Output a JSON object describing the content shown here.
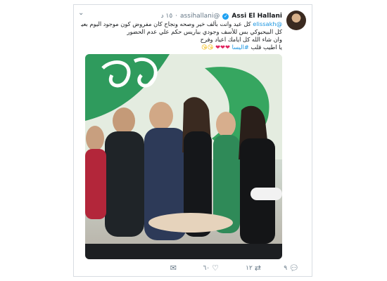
{
  "tweet": {
    "display_name": "Assi El Hallani",
    "handle": "@assihallani",
    "dot": "·",
    "timestamp": "١٥ د",
    "lines": [
      "كل عيد وانت بألف خير وصحه ونجاح كان مفروض كون موجود اليوم بعيدك مع",
      "كل البيحبوكي بس للأسف وجودي بباريس حكم علي عدم الحضور",
      "وان شاء الله كل ايامك اعياد وفرح"
    ],
    "mention": "@elissakh",
    "last_line_prefix": "يا اطيب قلب ",
    "hashtag": "#اليسا",
    "hearts": "❤❤❤",
    "smileys": "😘😘"
  },
  "actions": {
    "reply_count": "٩",
    "retweet_count": "١٢",
    "like_count": "٦٠"
  },
  "icons": {
    "verified": "verified-badge",
    "caret": "chevron-down",
    "reply": "speech-bubble",
    "retweet": "retweet-arrows",
    "like": "heart-outline",
    "dm": "envelope"
  },
  "colors": {
    "link": "#1b95e0",
    "verified": "#1da1f2",
    "muted": "#657786",
    "heart": "#e0245e"
  }
}
